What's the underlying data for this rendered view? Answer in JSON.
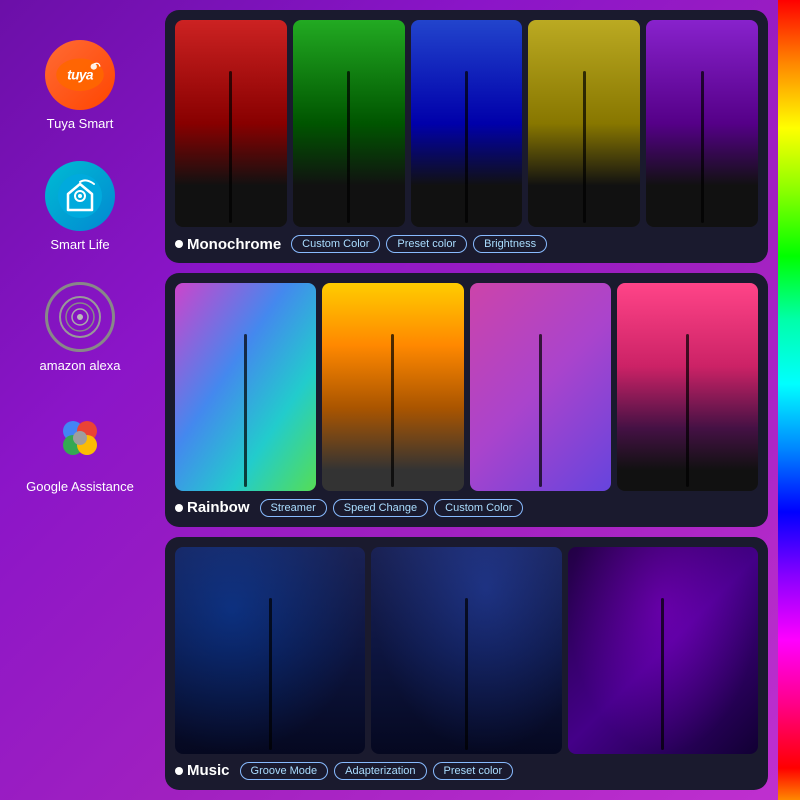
{
  "sidebar": {
    "items": [
      {
        "id": "tuya",
        "label": "Tuya Smart",
        "icon_text": "tuya",
        "icon_type": "tuya"
      },
      {
        "id": "smartlife",
        "label": "Smart Life",
        "icon_text": "🏠",
        "icon_type": "smartlife"
      },
      {
        "id": "alexa",
        "label": "amazon alexa",
        "icon_text": "◎",
        "icon_type": "alexa"
      },
      {
        "id": "google",
        "label": "Google Assistance",
        "icon_text": "●",
        "icon_type": "google"
      }
    ]
  },
  "sections": [
    {
      "id": "monochrome",
      "title": "Monochrome",
      "tags": [
        "Custom Color",
        "Preset color",
        "Brightness"
      ],
      "lamps": [
        "red",
        "green",
        "blue",
        "yellow",
        "purple"
      ]
    },
    {
      "id": "rainbow",
      "title": "Rainbow",
      "tags": [
        "Streamer",
        "Speed Change",
        "Custom Color"
      ],
      "lamps": [
        "rainbow1",
        "rainbow2",
        "rainbow3",
        "rainbow4"
      ]
    },
    {
      "id": "music",
      "title": "Music",
      "tags": [
        "Groove Mode",
        "Adapterization",
        "Preset color"
      ],
      "lamps": [
        "music1",
        "music2",
        "music3"
      ]
    }
  ]
}
